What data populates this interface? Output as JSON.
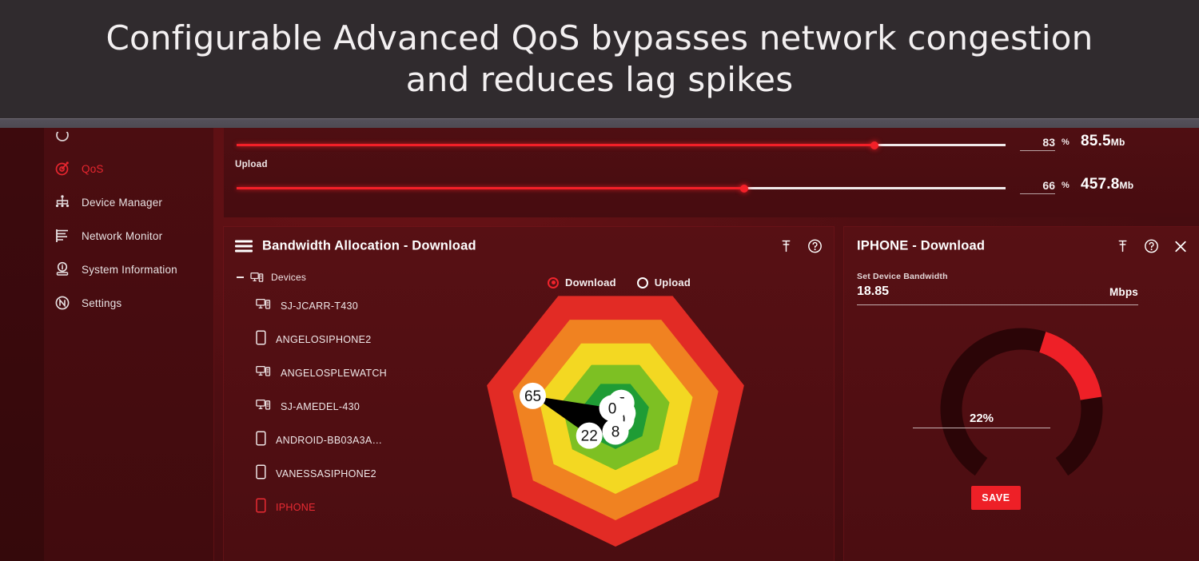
{
  "banner": {
    "line1": "Configurable Advanced QoS bypasses network congestion",
    "line2": "and reduces lag spikes"
  },
  "colors": {
    "accent_red": "#ee2027",
    "panel_bg": "#571014",
    "app_bg": "#4a0d10",
    "banner_bg": "#302b2e",
    "zone_green_dark": "#1f9c35",
    "zone_green_light": "#7dc023",
    "zone_yellow": "#f3d822",
    "zone_orange": "#f08221",
    "zone_red": "#e22b25"
  },
  "sidebar": {
    "items": [
      {
        "label": "",
        "icon": "cut-off-icon",
        "active": false,
        "partial": true
      },
      {
        "label": "QoS",
        "icon": "qos-target-icon",
        "active": true,
        "partial": false
      },
      {
        "label": "Device Manager",
        "icon": "device-manager-icon",
        "active": false,
        "partial": false
      },
      {
        "label": "Network Monitor",
        "icon": "network-monitor-icon",
        "active": false,
        "partial": false
      },
      {
        "label": "System Information",
        "icon": "system-information-icon",
        "active": false,
        "partial": false
      },
      {
        "label": "Settings",
        "icon": "settings-n-icon",
        "active": false,
        "partial": false
      }
    ]
  },
  "bandwidth": {
    "download": {
      "label": "",
      "percent": "83",
      "percent_symbol": "%",
      "value": "85.5",
      "unit": "Mb",
      "fill_ratio": 0.83
    },
    "upload": {
      "label": "Upload",
      "percent": "66",
      "percent_symbol": "%",
      "value": "457.8",
      "unit": "Mb",
      "fill_ratio": 0.66
    }
  },
  "allocation_panel": {
    "title": "Bandwidth Allocation - Download",
    "menu_icon": "hamburger-icon",
    "pin_icon": "pin-icon",
    "help_icon": "help-circle-icon",
    "tree_root": "Devices",
    "direction_options": [
      {
        "label": "Download",
        "selected": true
      },
      {
        "label": "Upload",
        "selected": false
      }
    ],
    "devices": [
      {
        "name": "SJ-JCARR-T430",
        "icon": "desktop-icon",
        "selected": false
      },
      {
        "name": "ANGELOSIPHONE2",
        "icon": "phone-icon",
        "selected": false
      },
      {
        "name": "ANGELOSPLEWATCH",
        "icon": "desktop-icon",
        "selected": false
      },
      {
        "name": "SJ-AMEDEL-430",
        "icon": "desktop-icon",
        "selected": false
      },
      {
        "name": "ANDROID-BB03A3A…",
        "icon": "phone-icon",
        "selected": false
      },
      {
        "name": "VANESSASIPHONE2",
        "icon": "phone-icon",
        "selected": false
      },
      {
        "name": "IPHONE",
        "icon": "phone-icon",
        "selected": true
      }
    ]
  },
  "device_panel": {
    "title": "IPHONE - Download",
    "pin_icon": "pin-icon",
    "help_icon": "help-circle-icon",
    "close_icon": "close-icon",
    "field_label": "Set Device Bandwidth",
    "field_value": "18.85",
    "field_unit": "Mbps",
    "gauge_percent": "22%",
    "gauge_ratio": 0.22,
    "save_label": "SAVE"
  },
  "chart_data": {
    "type": "radar",
    "title": "Bandwidth Allocation - Download",
    "sides": 7,
    "rings": 5,
    "ring_colors": [
      "#1f9c35",
      "#7dc023",
      "#f3d822",
      "#f08221",
      "#e22b25"
    ],
    "ring_max": 100,
    "fill_color": "#000000",
    "categories": [
      "SJ-JCARR-T430",
      "ANGELOSIPHONE2",
      "ANGELOSPLEWATCH",
      "SJ-AMEDEL-430",
      "ANDROID-BB03A3A…",
      "VANESSASIPHONE2",
      "IPHONE"
    ],
    "values": [
      5,
      0,
      0,
      8,
      22,
      65,
      0
    ],
    "point_labels": [
      "5",
      "0",
      "0",
      "8",
      "22",
      "65",
      "0"
    ],
    "grid": true,
    "legend": "none",
    "ylim": [
      0,
      100
    ]
  }
}
